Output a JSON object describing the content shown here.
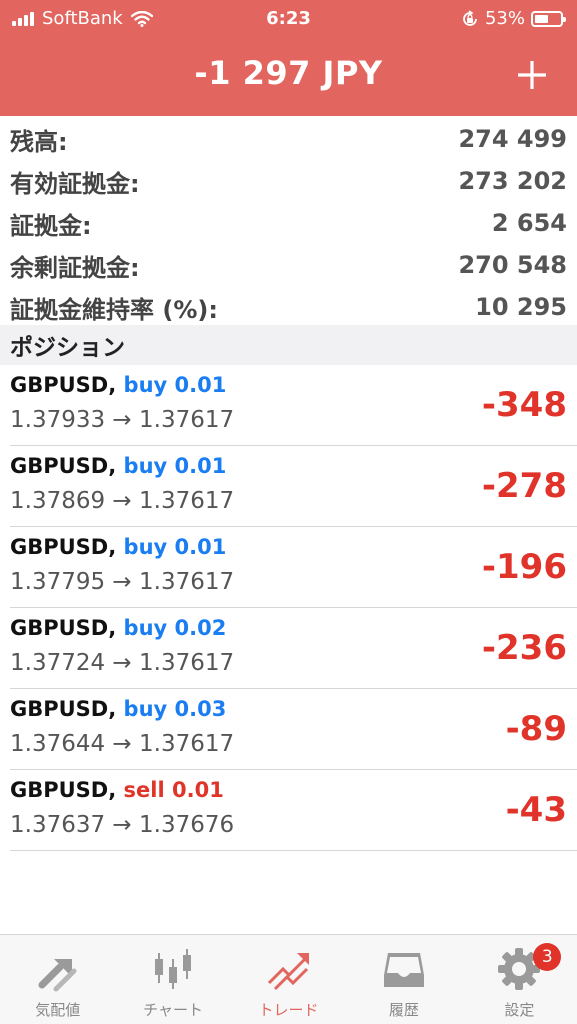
{
  "status_bar": {
    "carrier": "SoftBank",
    "time": "6:23",
    "battery": "53%"
  },
  "header": {
    "title": "-1 297 JPY",
    "add_icon": "plus-icon",
    "background_color": "#e2665f"
  },
  "summary": [
    {
      "label": "残高:",
      "value": "274 499"
    },
    {
      "label": "有効証拠金:",
      "value": "273 202"
    },
    {
      "label": "証拠金:",
      "value": "2 654"
    },
    {
      "label": "余剰証拠金:",
      "value": "270 548"
    },
    {
      "label": "証拠金維持率 (%):",
      "value": "10 295"
    }
  ],
  "positions_section": {
    "title": "ポジション"
  },
  "positions": [
    {
      "symbol": "GBPUSD,",
      "direction": "buy 0.01",
      "prices": "1.37933 → 1.37617",
      "pl": "-348"
    },
    {
      "symbol": "GBPUSD,",
      "direction": "buy 0.01",
      "prices": "1.37869 → 1.37617",
      "pl": "-278"
    },
    {
      "symbol": "GBPUSD,",
      "direction": "buy 0.01",
      "prices": "1.37795 → 1.37617",
      "pl": "-196"
    },
    {
      "symbol": "GBPUSD,",
      "direction": "buy 0.02",
      "prices": "1.37724 → 1.37617",
      "pl": "-236"
    },
    {
      "symbol": "GBPUSD,",
      "direction": "buy 0.03",
      "prices": "1.37644 → 1.37617",
      "pl": "-89"
    },
    {
      "symbol": "GBPUSD,",
      "direction": "sell 0.01",
      "prices": "1.37637 → 1.37676",
      "pl": "-43"
    }
  ],
  "colors": {
    "buy": "#1a7ef2",
    "sell": "#e0342a",
    "loss": "#e0342a",
    "active_tab": "#e2665f"
  },
  "tabbar": {
    "tabs": [
      {
        "label": "気配値",
        "icon": "quotes-arrows-icon"
      },
      {
        "label": "チャート",
        "icon": "candlestick-chart-icon"
      },
      {
        "label": "トレード",
        "icon": "trade-trend-icon"
      },
      {
        "label": "履歴",
        "icon": "history-inbox-icon"
      },
      {
        "label": "設定",
        "icon": "settings-gear-icon",
        "badge": "3"
      }
    ],
    "active": "トレード"
  }
}
